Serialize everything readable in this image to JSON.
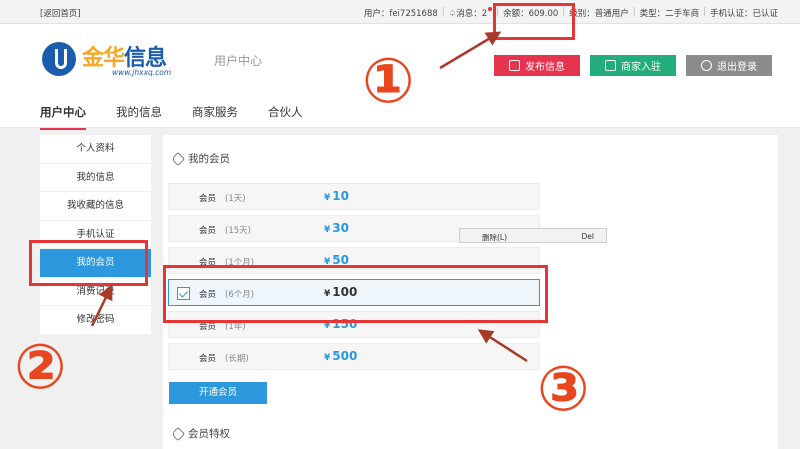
{
  "topbar": {
    "back_link": "[返回首页]",
    "user": "用户：fei7251688",
    "messages": "消息：2",
    "balance": "余额：609.00",
    "level": "级别：普通用户",
    "type": "类型：二手车商",
    "phone_verify": "手机认证：已认证"
  },
  "header": {
    "logo_text_a": "金华",
    "logo_text_b": "信息",
    "logo_url": "www.jhxxq.com",
    "subtitle": "用户中心",
    "buttons": {
      "publish": "发布信息",
      "merchant": "商家入驻",
      "logout": "退出登录"
    },
    "nav": [
      "用户中心",
      "我的信息",
      "商家服务",
      "合伙人"
    ]
  },
  "sidebar": {
    "items": [
      "个人资料",
      "我的信息",
      "我收藏的信息",
      "手机认证",
      "我的会员",
      "消费记录",
      "修改密码"
    ]
  },
  "main": {
    "section_title": "我的会员",
    "rows": [
      {
        "label": "会员",
        "duration": "(1天)",
        "price": "10"
      },
      {
        "label": "会员",
        "duration": "(15天)",
        "price": "30"
      },
      {
        "label": "会员",
        "duration": "(1个月)",
        "price": "50"
      },
      {
        "label": "会员",
        "duration": "(6个月)",
        "price": "100"
      },
      {
        "label": "会员",
        "duration": "(1年)",
        "price": "150"
      },
      {
        "label": "会员",
        "duration": "(长期)",
        "price": "500"
      }
    ],
    "currency": "¥",
    "open_button": "开通会员",
    "privileges_title": "会员特权"
  },
  "context_menu": {
    "item": "删除(L)",
    "shortcut": "Del"
  },
  "annotations": [
    "①",
    "②",
    "③"
  ],
  "colors": {
    "accent_blue": "#2d98de",
    "publish_red": "#e6334e",
    "merchant_green": "#23ad7a",
    "logout_gray": "#8c8c8c",
    "annotation_red": "#e53535"
  }
}
